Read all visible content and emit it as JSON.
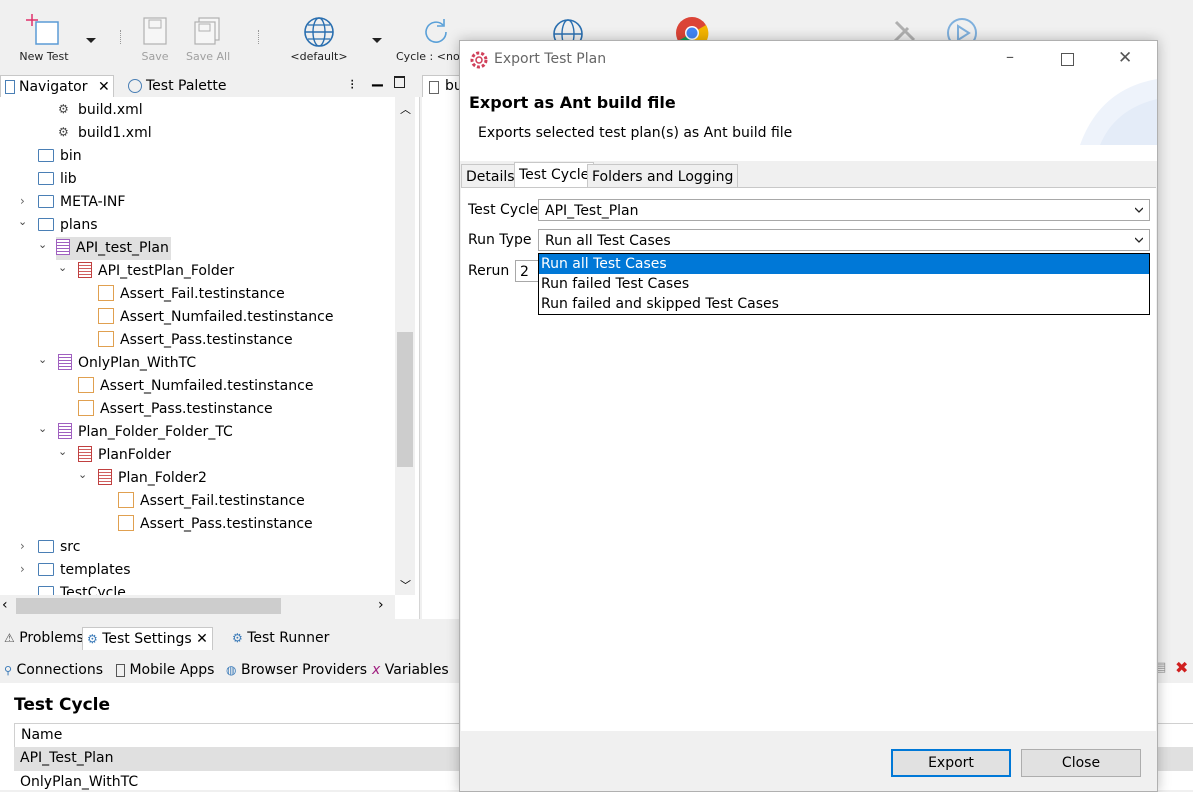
{
  "toolbar": {
    "new_test": "New Test",
    "save": "Save",
    "save_all": "Save All",
    "environment": "<default>",
    "cycle": "Cycle : <nor"
  },
  "navigator": {
    "tabs": [
      {
        "label": "Navigator"
      },
      {
        "label": "Test Palette"
      }
    ],
    "tree": [
      {
        "label": "build.xml"
      },
      {
        "label": "build1.xml"
      },
      {
        "label": "bin"
      },
      {
        "label": "lib"
      },
      {
        "label": "META-INF"
      },
      {
        "label": "plans"
      },
      {
        "label": "API_test_Plan"
      },
      {
        "label": "API_testPlan_Folder"
      },
      {
        "label": "Assert_Fail.testinstance"
      },
      {
        "label": "Assert_Numfailed.testinstance"
      },
      {
        "label": "Assert_Pass.testinstance"
      },
      {
        "label": "OnlyPlan_WithTC"
      },
      {
        "label": "Assert_Numfailed.testinstance"
      },
      {
        "label": "Assert_Pass.testinstance"
      },
      {
        "label": "Plan_Folder_Folder_TC"
      },
      {
        "label": "PlanFolder"
      },
      {
        "label": "Plan_Folder2"
      },
      {
        "label": "Assert_Fail.testinstance"
      },
      {
        "label": "Assert_Pass.testinstance"
      },
      {
        "label": "src"
      },
      {
        "label": "templates"
      },
      {
        "label": "TestCycle"
      }
    ]
  },
  "editor": {
    "tab_label": "bu"
  },
  "bottom": {
    "tabs": [
      {
        "label": "Problems"
      },
      {
        "label": "Test Settings"
      },
      {
        "label": "Test Runner"
      }
    ],
    "subtabs": [
      {
        "label": "Connections"
      },
      {
        "label": "Mobile Apps"
      },
      {
        "label": "Browser Providers"
      },
      {
        "label": "Variables"
      }
    ],
    "section_title": "Test Cycle",
    "column_header": "Name",
    "rows": [
      {
        "name": "API_Test_Plan"
      },
      {
        "name": "OnlyPlan_WithTC"
      }
    ]
  },
  "dialog": {
    "title": "Export Test Plan",
    "heading": "Export as Ant build file",
    "description": "Exports selected test plan(s) as Ant build file",
    "tabs": [
      {
        "label": "Details"
      },
      {
        "label": "Test Cycle"
      },
      {
        "label": "Folders and Logging"
      }
    ],
    "fields": {
      "test_cycle_label": "Test Cycle",
      "test_cycle_value": "API_Test_Plan",
      "run_type_label": "Run Type",
      "run_type_value": "Run all Test Cases",
      "rerun_label": "Rerun",
      "rerun_value": "2"
    },
    "run_type_options": [
      {
        "label": "Run all Test Cases"
      },
      {
        "label": "Run failed Test Cases"
      },
      {
        "label": "Run failed and skipped Test Cases"
      }
    ],
    "buttons": {
      "export": "Export",
      "close": "Close"
    }
  },
  "colors": {
    "accent": "#0078d7",
    "selection": "#e0e0e0"
  }
}
